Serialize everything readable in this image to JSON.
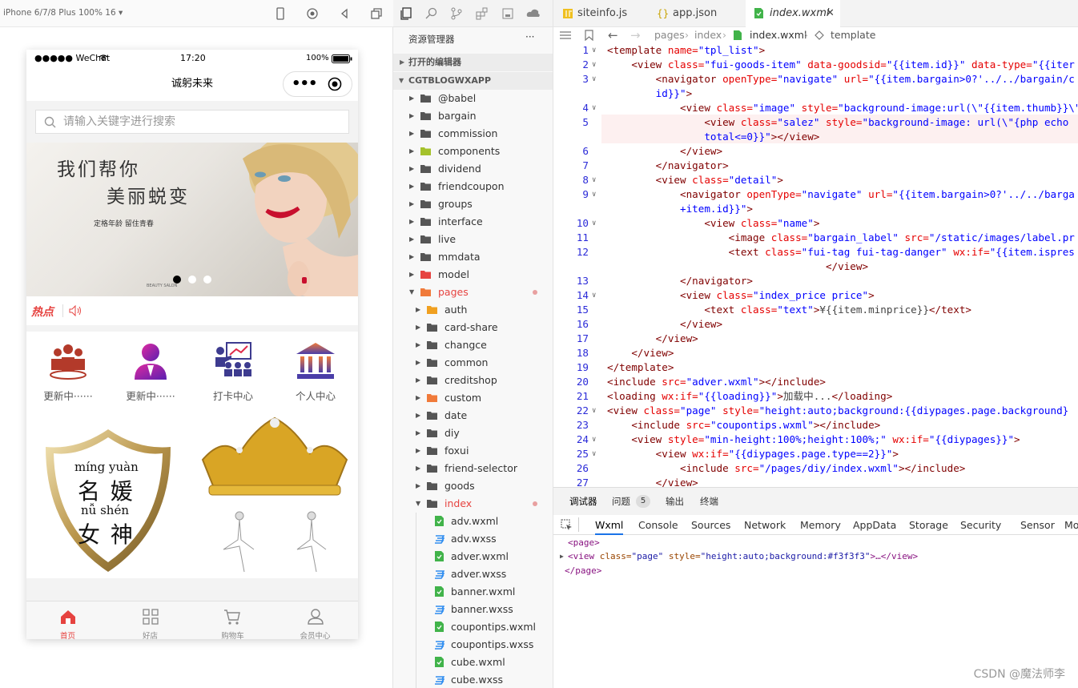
{
  "simulator": {
    "device": "iPhone 6/7/8 Plus 100% 16 ▾"
  },
  "phone": {
    "status": {
      "carrier": "●●●●● WeChat",
      "time": "17:20",
      "battery": "100%"
    },
    "title": "诚躬未来",
    "capsule_more": "•••",
    "search_placeholder": "请输入关键字进行搜索",
    "banner": {
      "line1": "我们帮你",
      "line2": "美丽蜕变",
      "line3": "定格年龄 留住青春",
      "brand": "BEAUTY SALON"
    },
    "hot_label": "热点",
    "menu": [
      {
        "label": "更新中······"
      },
      {
        "label": "更新中······"
      },
      {
        "label": "打卡中心"
      },
      {
        "label": "个人中心"
      }
    ],
    "art": {
      "pinyin1": "míng yuàn",
      "chars1": "名 媛",
      "pinyin2": "nǚ  shén",
      "chars2": "女 神"
    },
    "tabbar": [
      {
        "label": "首页"
      },
      {
        "label": "好店"
      },
      {
        "label": "购物车"
      },
      {
        "label": "会员中心"
      }
    ]
  },
  "explorer": {
    "title": "资源管理器",
    "more": "···",
    "open_editors": "打开的编辑器",
    "project": "CGTBLOGWXAPP",
    "folders": [
      "@babel",
      "bargain",
      "commission",
      "components",
      "dividend",
      "friendcoupon",
      "groups",
      "interface",
      "live",
      "mmdata",
      "model",
      "pages"
    ],
    "pages_children": [
      "auth",
      "card-share",
      "changce",
      "common",
      "creditshop",
      "custom",
      "date",
      "diy",
      "foxui",
      "friend-selector",
      "goods",
      "index"
    ],
    "index_files": [
      "adv.wxml",
      "adv.wxss",
      "adver.wxml",
      "adver.wxss",
      "banner.wxml",
      "banner.wxss",
      "coupontips.wxml",
      "coupontips.wxss",
      "cube.wxml",
      "cube.wxss"
    ]
  },
  "editor": {
    "tabs": [
      "siteinfo.js",
      "app.json",
      "index.wxml"
    ],
    "breadcrumb": {
      "p1": "pages",
      "p2": "index",
      "p3": "index.wxml",
      "p4": "template"
    },
    "lines": [
      {
        "n": "1",
        "segs": [
          [
            "t",
            "<template"
          ],
          [
            "a",
            " name="
          ],
          [
            "s",
            "\"tpl_list\""
          ],
          [
            "t",
            ">"
          ]
        ]
      },
      {
        "n": "2",
        "segs": [
          [
            "p",
            "    "
          ],
          [
            "t",
            "<view"
          ],
          [
            "a",
            " class="
          ],
          [
            "s",
            "\"fui-goods-item\""
          ],
          [
            "a",
            " data-goodsid="
          ],
          [
            "s",
            "\"{{item.id}}\""
          ],
          [
            "a",
            " data-type="
          ],
          [
            "s",
            "\"{{iter"
          ]
        ]
      },
      {
        "n": "3",
        "segs": [
          [
            "p",
            "        "
          ],
          [
            "t",
            "<navigator"
          ],
          [
            "a",
            " openType="
          ],
          [
            "s",
            "\"navigate\""
          ],
          [
            "a",
            " url="
          ],
          [
            "s",
            "\"{{item.bargain>0?'../../bargain/c"
          ]
        ]
      },
      {
        "n": "",
        "segs": [
          [
            "p",
            "        "
          ],
          [
            "s",
            "id}}\""
          ],
          [
            "t",
            ">"
          ]
        ]
      },
      {
        "n": "4",
        "segs": [
          [
            "p",
            "            "
          ],
          [
            "t",
            "<view"
          ],
          [
            "a",
            " class="
          ],
          [
            "s",
            "\"image\""
          ],
          [
            "a",
            " style="
          ],
          [
            "s",
            "\"background-image:url(\\\"{{item.thumb}}\\\""
          ]
        ]
      },
      {
        "n": "5",
        "segs": [
          [
            "p",
            "                "
          ],
          [
            "t",
            "<view"
          ],
          [
            "a",
            " class="
          ],
          [
            "s",
            "\"salez\""
          ],
          [
            "a",
            " style="
          ],
          [
            "s",
            "\"background-image: url(\\\"{php echo"
          ]
        ]
      },
      {
        "n": "",
        "segs": [
          [
            "p",
            "                "
          ],
          [
            "s",
            "total<=0}}\""
          ],
          [
            "t",
            "></view>"
          ]
        ]
      },
      {
        "n": "6",
        "segs": [
          [
            "p",
            "            "
          ],
          [
            "t",
            "</view>"
          ]
        ]
      },
      {
        "n": "7",
        "segs": [
          [
            "p",
            "        "
          ],
          [
            "t",
            "</navigator>"
          ]
        ]
      },
      {
        "n": "8",
        "segs": [
          [
            "p",
            "        "
          ],
          [
            "t",
            "<view"
          ],
          [
            "a",
            " class="
          ],
          [
            "s",
            "\"detail\""
          ],
          [
            "t",
            ">"
          ]
        ]
      },
      {
        "n": "9",
        "segs": [
          [
            "p",
            "            "
          ],
          [
            "t",
            "<navigator"
          ],
          [
            "a",
            " openType="
          ],
          [
            "s",
            "\"navigate\""
          ],
          [
            "a",
            " url="
          ],
          [
            "s",
            "\"{{item.bargain>0?'../../barga"
          ]
        ]
      },
      {
        "n": "",
        "segs": [
          [
            "p",
            "            "
          ],
          [
            "s",
            "+item.id}}\""
          ],
          [
            "t",
            ">"
          ]
        ]
      },
      {
        "n": "10",
        "segs": [
          [
            "p",
            "                "
          ],
          [
            "t",
            "<view"
          ],
          [
            "a",
            " class="
          ],
          [
            "s",
            "\"name\""
          ],
          [
            "t",
            ">"
          ]
        ]
      },
      {
        "n": "11",
        "segs": [
          [
            "p",
            "                    "
          ],
          [
            "t",
            "<image"
          ],
          [
            "a",
            " class="
          ],
          [
            "s",
            "\"bargain_label\""
          ],
          [
            "a",
            " src="
          ],
          [
            "s",
            "\"/static/images/label.pr"
          ]
        ]
      },
      {
        "n": "12",
        "segs": [
          [
            "p",
            "                    "
          ],
          [
            "t",
            "<text"
          ],
          [
            "a",
            " class="
          ],
          [
            "s",
            "\"fui-tag fui-tag-danger\""
          ],
          [
            "a",
            " wx:if="
          ],
          [
            "s",
            "\"{{item.ispres"
          ]
        ]
      },
      {
        "n": "",
        "segs": [
          [
            "p",
            "                                    "
          ],
          [
            "t",
            "</view>"
          ]
        ]
      },
      {
        "n": "13",
        "segs": [
          [
            "p",
            "            "
          ],
          [
            "t",
            "</navigator>"
          ]
        ]
      },
      {
        "n": "14",
        "segs": [
          [
            "p",
            "            "
          ],
          [
            "t",
            "<view"
          ],
          [
            "a",
            " class="
          ],
          [
            "s",
            "\"index_price price\""
          ],
          [
            "t",
            ">"
          ]
        ]
      },
      {
        "n": "15",
        "segs": [
          [
            "p",
            "                "
          ],
          [
            "t",
            "<text"
          ],
          [
            "a",
            " class="
          ],
          [
            "s",
            "\"text\""
          ],
          [
            "t",
            ">"
          ],
          [
            "g",
            "¥{{item.minprice}}"
          ],
          [
            "t",
            "</text>"
          ]
        ]
      },
      {
        "n": "16",
        "segs": [
          [
            "p",
            "            "
          ],
          [
            "t",
            "</view>"
          ]
        ]
      },
      {
        "n": "17",
        "segs": [
          [
            "p",
            "        "
          ],
          [
            "t",
            "</view>"
          ]
        ]
      },
      {
        "n": "18",
        "segs": [
          [
            "p",
            "    "
          ],
          [
            "t",
            "</view>"
          ]
        ]
      },
      {
        "n": "19",
        "segs": [
          [
            "t",
            "</template>"
          ]
        ]
      },
      {
        "n": "20",
        "segs": [
          [
            "t",
            "<include"
          ],
          [
            "a",
            " src="
          ],
          [
            "s",
            "\"adver.wxml\""
          ],
          [
            "t",
            "></include>"
          ]
        ]
      },
      {
        "n": "21",
        "segs": [
          [
            "t",
            "<loading"
          ],
          [
            "a",
            " wx:if="
          ],
          [
            "s",
            "\"{{loading}}\""
          ],
          [
            "t",
            ">"
          ],
          [
            "g",
            "加载中..."
          ],
          [
            "t",
            "</loading>"
          ]
        ]
      },
      {
        "n": "22",
        "segs": [
          [
            "t",
            "<view"
          ],
          [
            "a",
            " class="
          ],
          [
            "s",
            "\"page\""
          ],
          [
            "a",
            " style="
          ],
          [
            "s",
            "\"height:auto;background:{{diypages.page.background}"
          ]
        ]
      },
      {
        "n": "23",
        "segs": [
          [
            "p",
            "    "
          ],
          [
            "t",
            "<include"
          ],
          [
            "a",
            " src="
          ],
          [
            "s",
            "\"coupontips.wxml\""
          ],
          [
            "t",
            "></include>"
          ]
        ]
      },
      {
        "n": "24",
        "segs": [
          [
            "p",
            "    "
          ],
          [
            "t",
            "<view"
          ],
          [
            "a",
            " style="
          ],
          [
            "s",
            "\"min-height:100%;height:100%;\""
          ],
          [
            "a",
            " wx:if="
          ],
          [
            "s",
            "\"{{diypages}}\""
          ],
          [
            "t",
            ">"
          ]
        ]
      },
      {
        "n": "25",
        "segs": [
          [
            "p",
            "        "
          ],
          [
            "t",
            "<view"
          ],
          [
            "a",
            " wx:if="
          ],
          [
            "s",
            "\"{{diypages.page.type==2}}\""
          ],
          [
            "t",
            ">"
          ]
        ]
      },
      {
        "n": "26",
        "segs": [
          [
            "p",
            "            "
          ],
          [
            "t",
            "<include"
          ],
          [
            "a",
            " src="
          ],
          [
            "s",
            "\"/pages/diy/index.wxml\""
          ],
          [
            "t",
            "></include>"
          ]
        ]
      },
      {
        "n": "27",
        "segs": [
          [
            "p",
            "        "
          ],
          [
            "t",
            "</view>"
          ]
        ]
      }
    ]
  },
  "debugger": {
    "tabs": [
      "调试器",
      "问题",
      "输出",
      "终端"
    ],
    "issues_count": "5",
    "devtools_tabs": [
      "Wxml",
      "Console",
      "Sources",
      "Network",
      "Memory",
      "AppData",
      "Storage",
      "Security",
      "Sensor",
      "Mo"
    ],
    "dom": {
      "l1": "<page>",
      "l2a": "<view",
      "l2b": " class=",
      "l2c": "\"page\"",
      "l2d": " style=",
      "l2e": "\"height:auto;background:#f3f3f3\"",
      "l2f": ">…</view>",
      "l3": "</page>"
    }
  },
  "watermark": "CSDN @魔法师李",
  "colors": {
    "accent_red": "#e64340",
    "link_blue": "#0000ff",
    "tag_maroon": "#800000",
    "attr_red": "#e50000"
  }
}
